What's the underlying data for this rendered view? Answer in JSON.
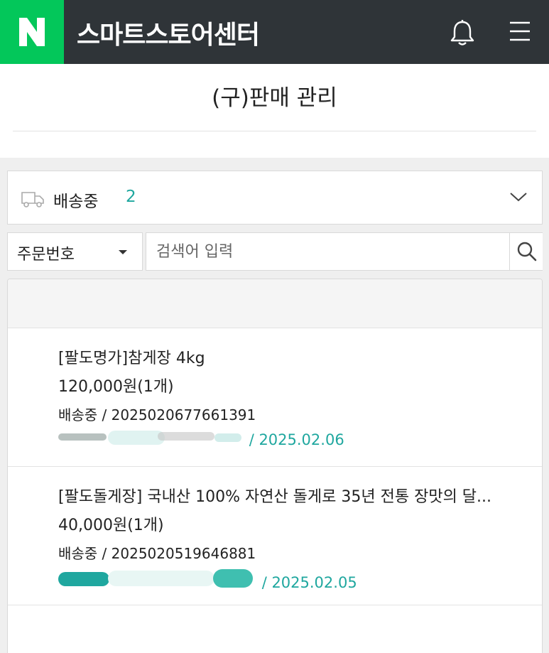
{
  "header": {
    "logo_letter": "N",
    "app_title": "스마트스토어센터",
    "bell_icon": "bell-icon",
    "menu_icon": "hamburger-menu-icon"
  },
  "page": {
    "title": "(구)판매 관리"
  },
  "status_filter": {
    "icon": "truck-icon",
    "label": "배송중",
    "count": "2"
  },
  "search": {
    "field_select": "주문번호",
    "placeholder": "검색어 입력",
    "value": "",
    "icon": "search-icon"
  },
  "orders": [
    {
      "name": "[팔도명가]참게장 4kg",
      "price": "120,000원(1개)",
      "status_line": "배송중 / 2025020677661391",
      "date": "/ 2025.02.06"
    },
    {
      "name": "[팔도돌게장] 국내산 100% 자연산 돌게로 35년 전통 장맛의 달...",
      "price": "40,000원(1개)",
      "status_line": "배송중 / 2025020519646881",
      "date": "/ 2025.02.05"
    }
  ],
  "colors": {
    "brand_green": "#03c75a",
    "header_bg": "#2f3438",
    "accent_teal": "#1fa79f"
  }
}
